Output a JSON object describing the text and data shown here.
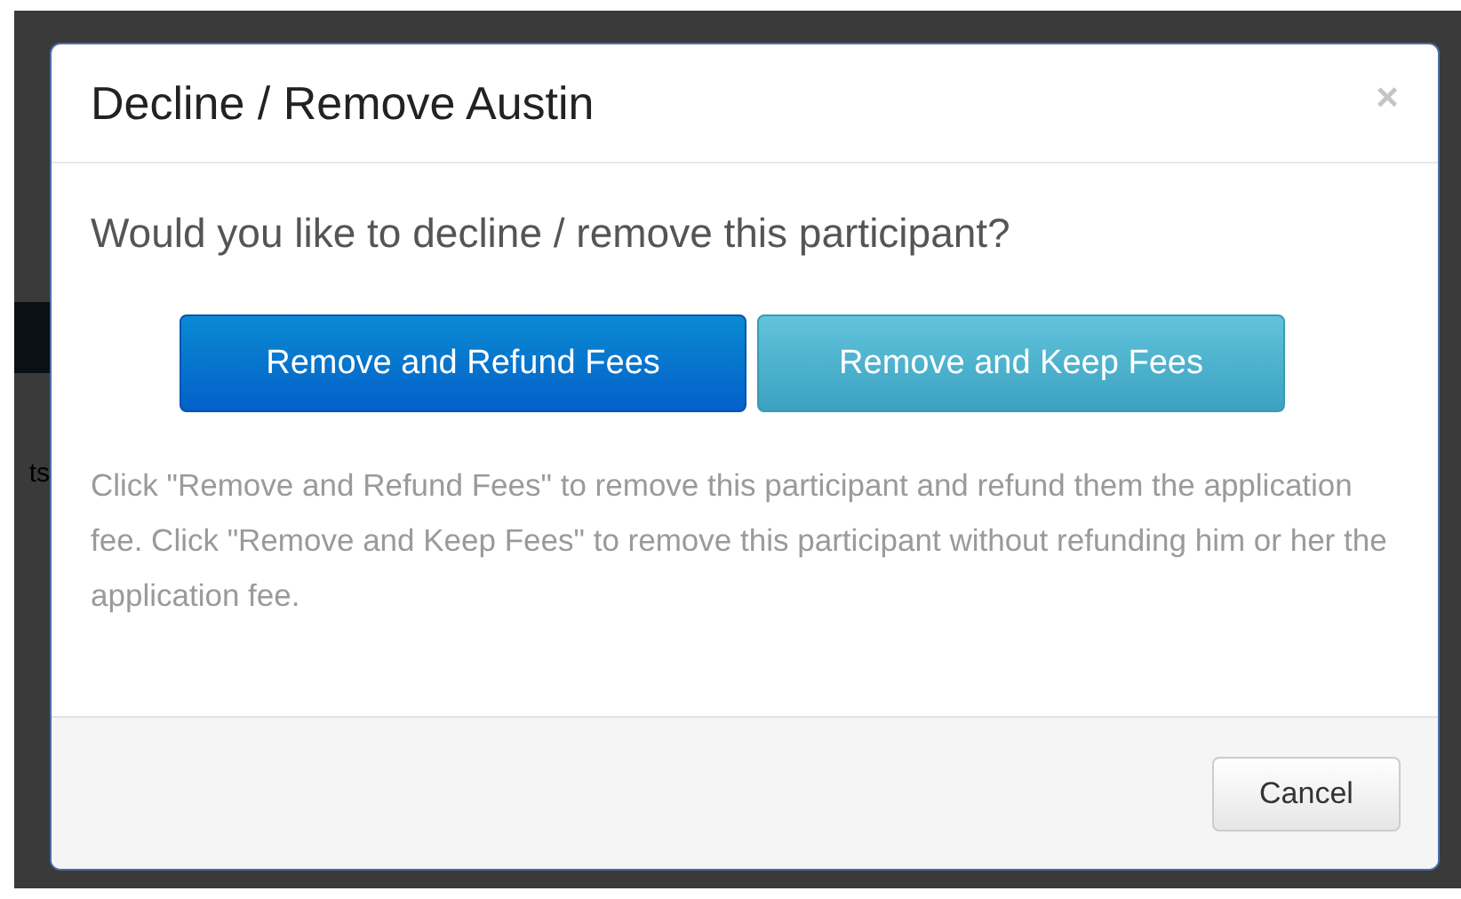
{
  "background": {
    "page_text": "ts"
  },
  "modal": {
    "title": "Decline / Remove Austin",
    "close": "×",
    "question": "Would you like to decline / remove this participant?",
    "actions": [
      {
        "label": "Remove and Refund Fees",
        "kind": "primary"
      },
      {
        "label": "Remove and Keep Fees",
        "kind": "info"
      }
    ],
    "description": "Click \"Remove and Refund Fees\" to remove this participant and refund them the application fee. Click \"Remove and Keep Fees\" to remove this participant without refunding him or her the application fee.",
    "footer_buttons": [
      {
        "label": "Cancel",
        "kind": "default"
      }
    ]
  }
}
